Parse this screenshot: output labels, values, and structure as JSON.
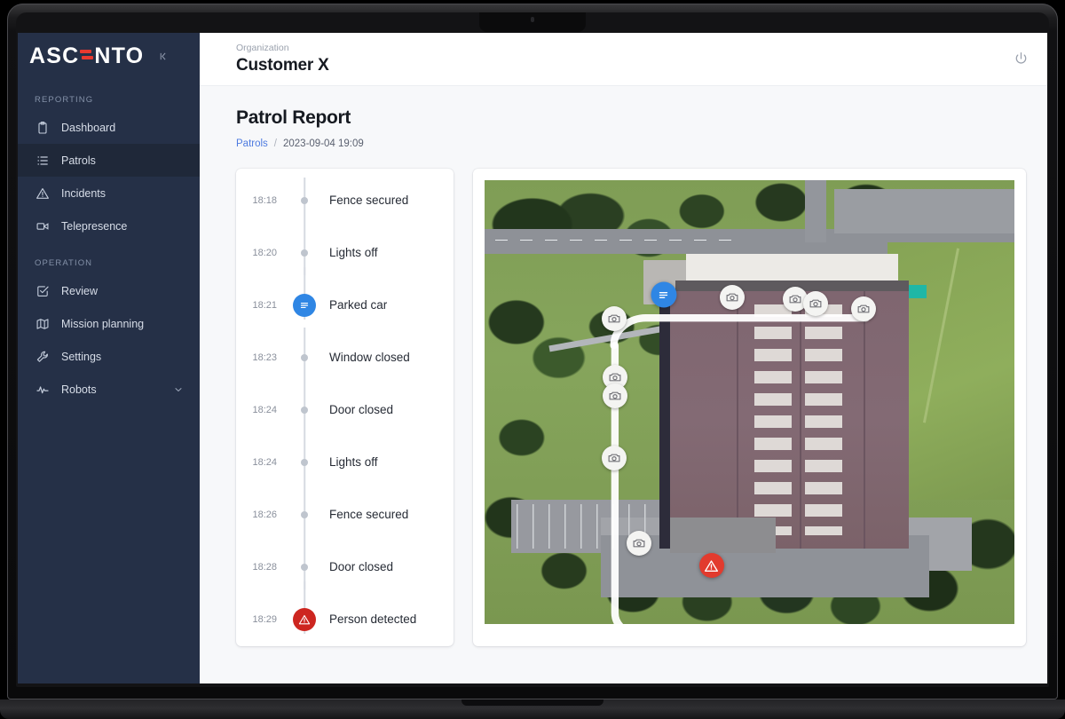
{
  "app": {
    "logo_text_left": "ASC",
    "logo_text_right": "NTO",
    "collapse_icon": "collapse-left-icon"
  },
  "sidebar": {
    "sections": [
      {
        "label": "REPORTING",
        "items": [
          {
            "label": "Dashboard",
            "icon": "clipboard-icon",
            "active": false
          },
          {
            "label": "Patrols",
            "icon": "list-icon",
            "active": true
          },
          {
            "label": "Incidents",
            "icon": "warning-triangle-icon",
            "active": false
          },
          {
            "label": "Telepresence",
            "icon": "video-camera-icon",
            "active": false
          }
        ]
      },
      {
        "label": "OPERATION",
        "items": [
          {
            "label": "Review",
            "icon": "checkbox-icon",
            "active": false
          },
          {
            "label": "Mission planning",
            "icon": "map-icon",
            "active": false
          },
          {
            "label": "Settings",
            "icon": "wrench-icon",
            "active": false
          },
          {
            "label": "Robots",
            "icon": "activity-pulse-icon",
            "active": false,
            "chevron": "chevron-down-icon"
          }
        ]
      }
    ]
  },
  "topbar": {
    "org_label": "Organization",
    "org_name": "Customer X",
    "power_icon": "power-icon"
  },
  "page": {
    "title": "Patrol Report",
    "breadcrumb": {
      "link": "Patrols",
      "separator": "/",
      "current": "2023-09-04 19:09"
    }
  },
  "timeline": {
    "events": [
      {
        "time": "18:18",
        "label": "Fence secured",
        "marker": "dot"
      },
      {
        "time": "18:20",
        "label": "Lights off",
        "marker": "dot"
      },
      {
        "time": "18:21",
        "label": "Parked car",
        "marker": "info"
      },
      {
        "time": "18:23",
        "label": "Window closed",
        "marker": "dot"
      },
      {
        "time": "18:24",
        "label": "Door closed",
        "marker": "dot"
      },
      {
        "time": "18:24",
        "label": "Lights off",
        "marker": "dot"
      },
      {
        "time": "18:26",
        "label": "Fence secured",
        "marker": "dot"
      },
      {
        "time": "18:28",
        "label": "Door closed",
        "marker": "dot"
      },
      {
        "time": "18:29",
        "label": "Person detected",
        "marker": "alert"
      }
    ]
  },
  "map": {
    "type": "satellite-aerial",
    "markers": [
      {
        "kind": "note",
        "icon": "note-lines-icon",
        "x": 33.8,
        "y": 25.8
      },
      {
        "kind": "cam",
        "icon": "camera-icon",
        "x": 46.7,
        "y": 26.4
      },
      {
        "kind": "cam",
        "icon": "camera-icon",
        "x": 58.6,
        "y": 26.8
      },
      {
        "kind": "cam",
        "icon": "camera-icon",
        "x": 62.5,
        "y": 27.8
      },
      {
        "kind": "cam",
        "icon": "camera-icon",
        "x": 71.6,
        "y": 29.0
      },
      {
        "kind": "cam",
        "icon": "camera-icon",
        "x": 24.4,
        "y": 31.2
      },
      {
        "kind": "cam",
        "icon": "camera-icon",
        "x": 24.6,
        "y": 44.4
      },
      {
        "kind": "cam",
        "icon": "camera-icon",
        "x": 24.6,
        "y": 48.6
      },
      {
        "kind": "cam",
        "icon": "camera-icon",
        "x": 24.4,
        "y": 62.6
      },
      {
        "kind": "cam",
        "icon": "camera-icon",
        "x": 29.2,
        "y": 81.8
      },
      {
        "kind": "alert",
        "icon": "warning-triangle-icon",
        "x": 42.8,
        "y": 86.8
      }
    ]
  },
  "colors": {
    "sidebar_bg": "#253047",
    "sidebar_active": "#1f2839",
    "accent_blue": "#2f86e4",
    "alert_red": "#cd2620",
    "brand_red": "#e8392f",
    "link_blue": "#4e7be0",
    "page_bg": "#f7f8fa"
  }
}
